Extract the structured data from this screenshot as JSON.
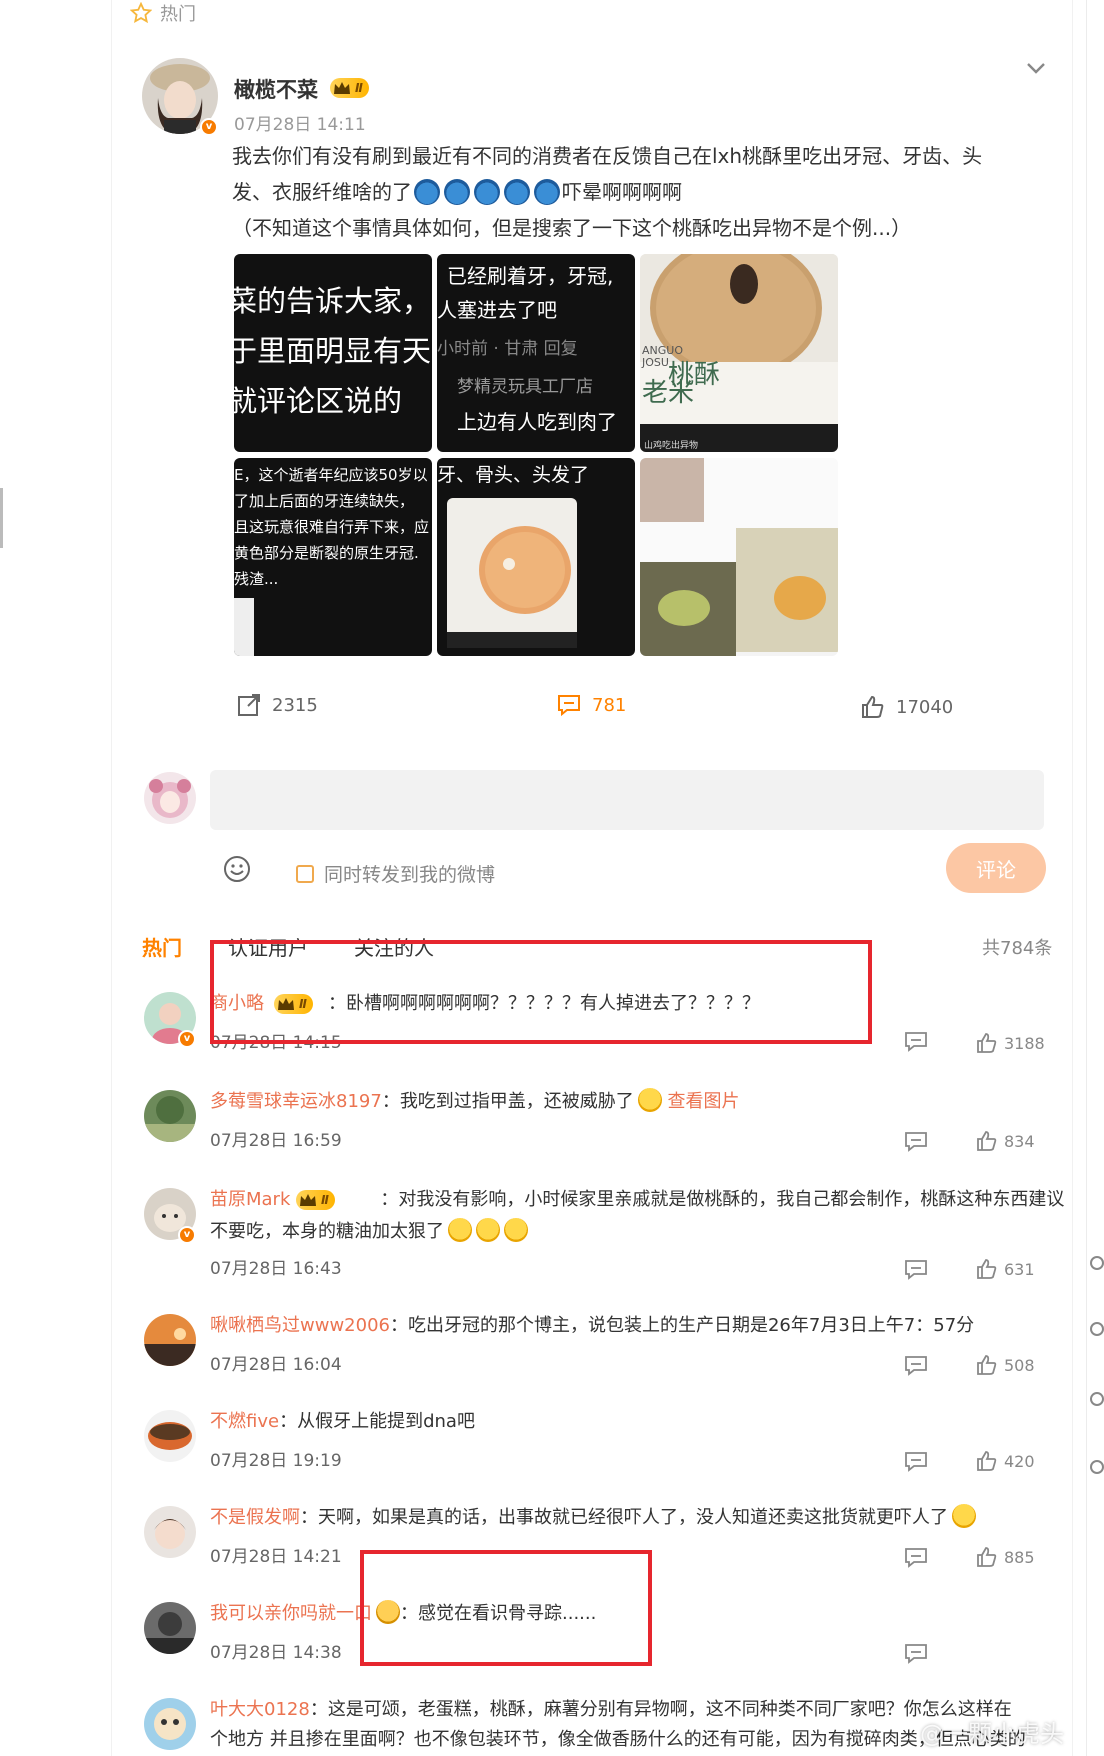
{
  "section": {
    "label": "热门"
  },
  "post": {
    "author": "橄榄不菜",
    "level": "Ⅱ",
    "time": "07月28日 14:11",
    "text_line1": "我去你们有没有刷到最近有不同的消费者在反馈自己在lxh桃酥里吃出牙冠、牙齿、头",
    "text_line2_a": "发、衣服纤维啥的了",
    "text_line2_b": "吓晕啊啊啊啊",
    "note": "（不知道这个事情具体如何，但是搜索了一下这个桃酥吃出异物不是个例...）",
    "images": {
      "t1": [
        "菜的告诉大家，",
        "于里面明显有天",
        "就评论区说的"
      ],
      "t2": [
        "已经刷着牙，牙冠,",
        "人塞进去了吧",
        "小时前 · 甘肃    回复",
        "梦精灵玩具工厂店",
        "上边有人吃到肉了"
      ],
      "t3": [
        "ANGUO",
        "JOSU",
        "老米",
        "桃酥",
        "山鸡吃出异物"
      ],
      "t4": [
        "E，这个逝者年纪应该50岁以",
        "了加上后面的牙连续缺失，",
        "且这玩意很难自行弄下来，应",
        "黄色部分是断裂的原生牙冠.",
        "残渣..."
      ],
      "t5": [
        "牙、骨头、头发了"
      ],
      "t6": []
    },
    "actions": {
      "repost": "2315",
      "comment": "781",
      "like": "17040"
    }
  },
  "compose": {
    "placeholder": "",
    "repost_label": "同时转发到我的微博",
    "submit_label": "评论"
  },
  "tabs": {
    "hot": "热门",
    "verified": "认证用户",
    "following": "关注的人"
  },
  "total": "共784条",
  "comments": [
    {
      "user": "商小略",
      "sep": "：",
      "text": "卧槽啊啊啊啊啊啊？？？？？有人掉进去了？？？？",
      "time": "07月28日 14:15",
      "likes": "3188"
    },
    {
      "user": "多莓雪球幸运冰8197",
      "sep": "：",
      "text": "我吃到过指甲盖，还被威胁了",
      "link": "查看图片",
      "time": "07月28日 16:59",
      "likes": "834"
    },
    {
      "user": "苗原Mark",
      "sep": "：",
      "text": "对我没有影响，小时候家里亲戚就是做桃酥的，我自己都会制作，桃酥这种东西建议",
      "text2": "不要吃，本身的糖油加太狠了",
      "time": "07月28日 16:43",
      "likes": "631"
    },
    {
      "user": "啾啾栖鸟过www2006",
      "sep": "：",
      "text": "吃出牙冠的那个博主，说包装上的生产日期是26年7月3日上午7：57分",
      "time": "07月28日 16:04",
      "likes": "508"
    },
    {
      "user": "不燃five",
      "sep": "：",
      "text": "从假牙上能提到dna吧",
      "time": "07月28日 19:19",
      "likes": "420"
    },
    {
      "user": "不是假发啊",
      "sep": "：",
      "text": "天啊，如果是真的话，出事故就已经很吓人了，没人知道还卖这批货就更吓人了",
      "time": "07月28日 14:21",
      "likes": "885"
    },
    {
      "user": "我可以亲你吗就一口",
      "sep": "：",
      "text": "感觉在看识骨寻踪......",
      "time": "07月28日 14:38",
      "likes": ""
    },
    {
      "user": "叶大大0128",
      "sep": "：",
      "text": "这是可颂，老蛋糕，桃酥，麻薯分别有异物啊，这不同种类不同厂家吧？你怎么这样在",
      "text2": "个地方 并且掺在里面啊？也不像包装环节，像全做香肠什么的还有可能，因为有搅碎肉类，但点心类的"
    }
  ],
  "watermark": "@一颗小虎头",
  "colors": {
    "accent": "#ff8200",
    "username": "#eb7350",
    "highlight_box": "#e6262e"
  }
}
